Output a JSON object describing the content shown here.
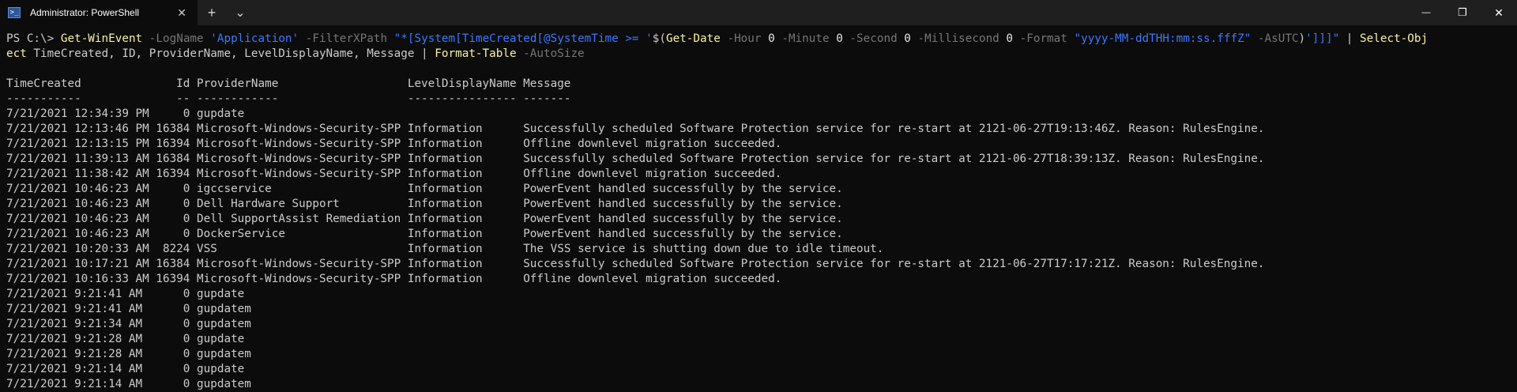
{
  "window": {
    "tab_title": "Administrator: PowerShell",
    "tab_close_glyph": "✕",
    "new_tab_glyph": "+",
    "dropdown_glyph": "⌄",
    "minimize_glyph": "—",
    "maximize_glyph": "❐",
    "close_glyph": "✕",
    "icon": "powershell-icon"
  },
  "colors": {
    "background": "#0c0c0c",
    "text": "#cccccc",
    "command": "#f9f1a5",
    "parameter": "#767676",
    "string": "#3b78ff"
  },
  "command": {
    "line1": [
      {
        "t": "PS C:\\> ",
        "c": "text"
      },
      {
        "t": "Get-WinEvent",
        "c": "cmd"
      },
      {
        "t": " -LogName ",
        "c": "param"
      },
      {
        "t": "'Application'",
        "c": "str"
      },
      {
        "t": " -FilterXPath ",
        "c": "param"
      },
      {
        "t": "\"*[System[TimeCreated[@SystemTime >= '",
        "c": "str"
      },
      {
        "t": "$(",
        "c": "text"
      },
      {
        "t": "Get-Date",
        "c": "cmd"
      },
      {
        "t": " -Hour ",
        "c": "param"
      },
      {
        "t": "0",
        "c": "num"
      },
      {
        "t": " -Minute ",
        "c": "param"
      },
      {
        "t": "0",
        "c": "num"
      },
      {
        "t": " -Second ",
        "c": "param"
      },
      {
        "t": "0",
        "c": "num"
      },
      {
        "t": " -Millisecond ",
        "c": "param"
      },
      {
        "t": "0",
        "c": "num"
      },
      {
        "t": " -Format ",
        "c": "param"
      },
      {
        "t": "\"yyyy-MM-ddTHH:mm:ss.fffZ\"",
        "c": "str"
      },
      {
        "t": " -AsUTC",
        "c": "param"
      },
      {
        "t": ")",
        "c": "text"
      },
      {
        "t": "']]]\"",
        "c": "str"
      },
      {
        "t": " | ",
        "c": "text"
      },
      {
        "t": "Select-Obj",
        "c": "cmd"
      }
    ],
    "line2": [
      {
        "t": "ect",
        "c": "cmd"
      },
      {
        "t": " TimeCreated, ID, ProviderName, LevelDisplayName, Message | ",
        "c": "text"
      },
      {
        "t": "Format-Table",
        "c": "cmd"
      },
      {
        "t": " -AutoSize",
        "c": "param"
      }
    ]
  },
  "output": {
    "header": "TimeCreated              Id ProviderName                   LevelDisplayName Message",
    "separator": "-----------              -- ------------                   ---------------- -------",
    "rows": [
      {
        "time": "7/21/2021 12:34:39 PM",
        "id": "0",
        "provider": "gupdate",
        "level": "",
        "message": ""
      },
      {
        "time": "7/21/2021 12:13:46 PM",
        "id": "16384",
        "provider": "Microsoft-Windows-Security-SPP",
        "level": "Information",
        "message": "Successfully scheduled Software Protection service for re-start at 2121-06-27T19:13:46Z. Reason: RulesEngine."
      },
      {
        "time": "7/21/2021 12:13:15 PM",
        "id": "16394",
        "provider": "Microsoft-Windows-Security-SPP",
        "level": "Information",
        "message": "Offline downlevel migration succeeded."
      },
      {
        "time": "7/21/2021 11:39:13 AM",
        "id": "16384",
        "provider": "Microsoft-Windows-Security-SPP",
        "level": "Information",
        "message": "Successfully scheduled Software Protection service for re-start at 2121-06-27T18:39:13Z. Reason: RulesEngine."
      },
      {
        "time": "7/21/2021 11:38:42 AM",
        "id": "16394",
        "provider": "Microsoft-Windows-Security-SPP",
        "level": "Information",
        "message": "Offline downlevel migration succeeded."
      },
      {
        "time": "7/21/2021 10:46:23 AM",
        "id": "0",
        "provider": "igccservice",
        "level": "Information",
        "message": "PowerEvent handled successfully by the service."
      },
      {
        "time": "7/21/2021 10:46:23 AM",
        "id": "0",
        "provider": "Dell Hardware Support",
        "level": "Information",
        "message": "PowerEvent handled successfully by the service."
      },
      {
        "time": "7/21/2021 10:46:23 AM",
        "id": "0",
        "provider": "Dell SupportAssist Remediation",
        "level": "Information",
        "message": "PowerEvent handled successfully by the service."
      },
      {
        "time": "7/21/2021 10:46:23 AM",
        "id": "0",
        "provider": "DockerService",
        "level": "Information",
        "message": "PowerEvent handled successfully by the service."
      },
      {
        "time": "7/21/2021 10:20:33 AM",
        "id": "8224",
        "provider": "VSS",
        "level": "Information",
        "message": "The VSS service is shutting down due to idle timeout."
      },
      {
        "time": "7/21/2021 10:17:21 AM",
        "id": "16384",
        "provider": "Microsoft-Windows-Security-SPP",
        "level": "Information",
        "message": "Successfully scheduled Software Protection service for re-start at 2121-06-27T17:17:21Z. Reason: RulesEngine."
      },
      {
        "time": "7/21/2021 10:16:33 AM",
        "id": "16394",
        "provider": "Microsoft-Windows-Security-SPP",
        "level": "Information",
        "message": "Offline downlevel migration succeeded."
      },
      {
        "time": "7/21/2021 9:21:41 AM",
        "id": "0",
        "provider": "gupdate",
        "level": "",
        "message": ""
      },
      {
        "time": "7/21/2021 9:21:41 AM",
        "id": "0",
        "provider": "gupdatem",
        "level": "",
        "message": ""
      },
      {
        "time": "7/21/2021 9:21:34 AM",
        "id": "0",
        "provider": "gupdatem",
        "level": "",
        "message": ""
      },
      {
        "time": "7/21/2021 9:21:28 AM",
        "id": "0",
        "provider": "gupdate",
        "level": "",
        "message": ""
      },
      {
        "time": "7/21/2021 9:21:28 AM",
        "id": "0",
        "provider": "gupdatem",
        "level": "",
        "message": ""
      },
      {
        "time": "7/21/2021 9:21:14 AM",
        "id": "0",
        "provider": "gupdate",
        "level": "",
        "message": ""
      },
      {
        "time": "7/21/2021 9:21:14 AM",
        "id": "0",
        "provider": "gupdatem",
        "level": "",
        "message": ""
      }
    ]
  }
}
